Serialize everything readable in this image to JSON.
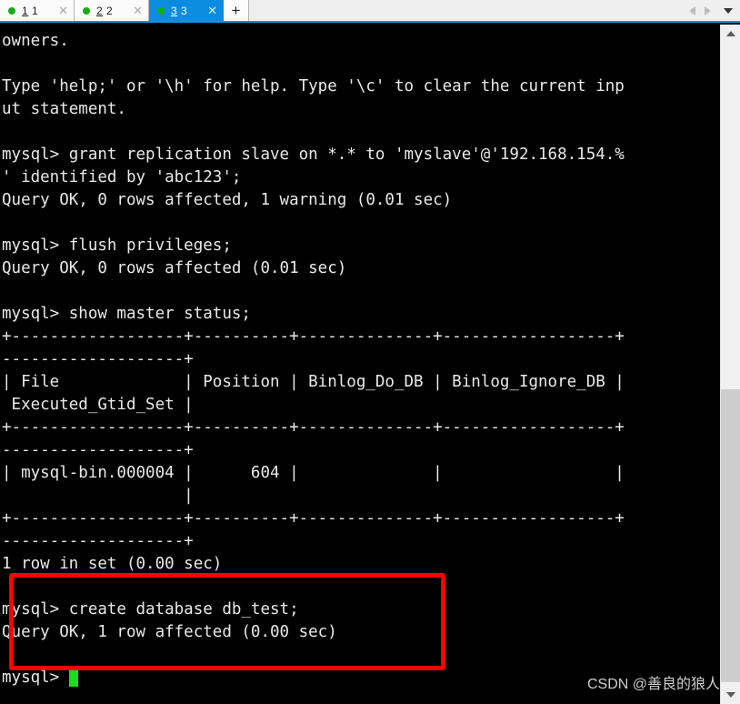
{
  "window": {
    "app_kind": "terminal-emulator",
    "accent_color": "#0c8ce0",
    "terminal_bg": "#000000",
    "terminal_fg": "#e9e9e9"
  },
  "tabbar": {
    "tabs": [
      {
        "label": "1 1",
        "accel": "1",
        "rest": " 1",
        "status_color": "#17ac17",
        "close_label": "✕",
        "active": false
      },
      {
        "label": "2 2",
        "accel": "2",
        "rest": " 2",
        "status_color": "#17ac17",
        "close_label": "✕",
        "active": false
      },
      {
        "label": "3 3",
        "accel": "3",
        "rest": " 3",
        "status_color": "#17ac17",
        "close_label": "✕",
        "active": true
      }
    ],
    "new_tab_label": "+",
    "nav": {
      "prev_label": "◀",
      "next_label": "▶",
      "list_label": "▾"
    }
  },
  "terminal": {
    "lines": [
      "owners.",
      "",
      "Type 'help;' or '\\h' for help. Type '\\c' to clear the current inp",
      "ut statement.",
      "",
      "mysql> grant replication slave on *.* to 'myslave'@'192.168.154.%",
      "' identified by 'abc123';",
      "Query OK, 0 rows affected, 1 warning (0.01 sec)",
      "",
      "mysql> flush privileges;",
      "Query OK, 0 rows affected (0.01 sec)",
      "",
      "mysql> show master status;",
      "+------------------+----------+--------------+------------------+",
      "-------------------+",
      "| File             | Position | Binlog_Do_DB | Binlog_Ignore_DB |",
      " Executed_Gtid_Set |",
      "+------------------+----------+--------------+------------------+",
      "-------------------+",
      "| mysql-bin.000004 |      604 |              |                  |",
      "                   |",
      "+------------------+----------+--------------+------------------+",
      "-------------------+",
      "1 row in set (0.00 sec)",
      "",
      "mysql> create database db_test;",
      "Query OK, 1 row affected (0.00 sec)",
      ""
    ],
    "prompt": "mysql> ",
    "cursor_color": "#15e015"
  },
  "annotation": {
    "highlight_color": "#ff0000",
    "highlight_shape": "rectangle"
  },
  "watermark": {
    "text": "CSDN @善良的狼人"
  },
  "scrollbar": {
    "up_arrow": "▲",
    "down_arrow": "▼",
    "thumb_color": "#cdcdcd",
    "track_color": "#f0f0f0"
  }
}
